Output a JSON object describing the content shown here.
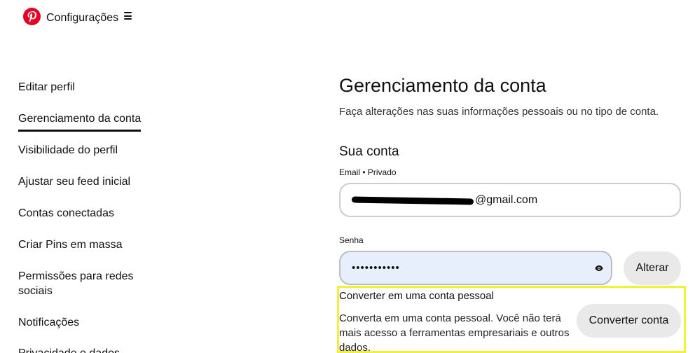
{
  "header": {
    "title": "Configurações"
  },
  "sidebar": {
    "items": [
      {
        "label": "Editar perfil"
      },
      {
        "label": "Gerenciamento da conta",
        "active": true
      },
      {
        "label": "Visibilidade do perfil"
      },
      {
        "label": "Ajustar seu feed inicial"
      },
      {
        "label": "Contas conectadas"
      },
      {
        "label": "Criar Pins em massa"
      },
      {
        "label": "Permissões para redes sociais"
      },
      {
        "label": "Notificações"
      },
      {
        "label": "Privacidade e dados"
      }
    ]
  },
  "main": {
    "title": "Gerenciamento da conta",
    "subtitle": "Faça alterações nas suas informações pessoais ou no tipo de conta.",
    "account_section": {
      "title": "Sua conta",
      "email_label": "Email • Privado",
      "email_visible_suffix": "@gmail.com",
      "password_label": "Senha",
      "password_value": "•••••••••••",
      "change_button": "Alterar"
    },
    "convert_section": {
      "title": "Converter em uma conta pessoal",
      "description": "Converta em uma conta pessoal. Você não terá mais acesso a ferramentas empresariais e outros dados.",
      "button": "Converter conta"
    }
  },
  "colors": {
    "brand": "#e60023",
    "highlight_border": "#f1f137",
    "password_bg": "#e8effc",
    "button_bg": "#e9e9e9"
  },
  "icons": {
    "logo": "pinterest-logo-icon",
    "menu": "hamburger-menu-icon",
    "show_password": "eye-icon"
  }
}
